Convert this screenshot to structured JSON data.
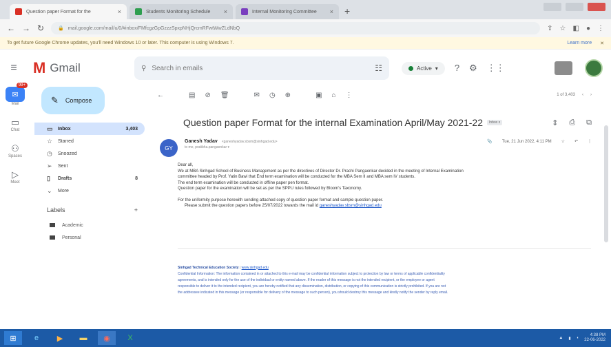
{
  "browser": {
    "tabs": [
      {
        "title": "Question paper Format for the",
        "active": true
      },
      {
        "title": "Students Monitoring Schedule",
        "active": false
      },
      {
        "title": "Internal Monitoring Committee",
        "active": false
      }
    ],
    "new_tab": "+",
    "url": "mail.google.com/mail/u/0/#inbox/FMfcgzGpGzzzSpxpNHjQrcmRFwtWwZLdNbQ",
    "infobar_text": "To get future Google Chrome updates, you'll need Windows 10 or later. This computer is using Windows 7.",
    "infobar_link": "Learn more"
  },
  "gmail": {
    "logo_text": "Gmail",
    "search_placeholder": "Search in emails",
    "status": "Active",
    "rail": [
      {
        "label": "Mail",
        "icon": "mail-icon",
        "badge": "99+"
      },
      {
        "label": "Chat",
        "icon": "chat-icon"
      },
      {
        "label": "Spaces",
        "icon": "spaces-icon"
      },
      {
        "label": "Meet",
        "icon": "video-icon"
      }
    ],
    "compose_label": "Compose",
    "nav": [
      {
        "label": "Inbox",
        "count": "3,403",
        "icon": "inbox-icon",
        "selected": true
      },
      {
        "label": "Starred",
        "count": "",
        "icon": "star-icon",
        "selected": false
      },
      {
        "label": "Snoozed",
        "count": "",
        "icon": "clock-icon",
        "selected": false
      },
      {
        "label": "Sent",
        "count": "",
        "icon": "send-icon",
        "selected": false
      },
      {
        "label": "Drafts",
        "count": "8",
        "icon": "draft-icon",
        "selected": false
      },
      {
        "label": "More",
        "count": "",
        "icon": "chevron-down-icon",
        "selected": false
      }
    ],
    "labels_title": "Labels",
    "labels_add": "+",
    "labels": [
      {
        "name": "Academic"
      },
      {
        "name": "Personal"
      }
    ],
    "pager_text": "1 of 3,403"
  },
  "email": {
    "subject": "Question paper Format for the internal Examination April/May 2021-22",
    "folder_chip": "Inbox x",
    "sender_initials": "GY",
    "sender_name": "Ganesh Yadav",
    "sender_email": "<ganeshyadav.sbsm@sinhgad.edu>",
    "to_text": "to me, pratibha.pangaonkar",
    "timestamp": "Tue, 21 Jun 2022, 4:11 PM",
    "body": [
      "Dear all,",
      "We at MBA Sinhgad School of Business Management as per the directives of Director Dr. Prachi Pangaonkar decided in the meeting of Internal Examination",
      "committee headed by Prof. Yatin Bawi that End term examination will be conducted for the MBA Sem II and MBA sem IV students.",
      "The end term examination will be conducted in offline paper pen format.",
      "Question paper for the examination will be set as per the SPPU rules followed by Bloom's Taxonomy.",
      "",
      "For the uniformity purpose herewith sending attached copy of question paper format and sample question paper.",
      "Please submit the question papers before 25/07/2022 towards the mail id"
    ],
    "mailto": "ganeshyadav.sbsm@sinhgad.edu",
    "footer_org": "Sinhgad Technical Education Society",
    "footer_link": "www.sinhgad.edu",
    "footer_text": [
      "Confidential Information: The information contained in or attached to this e-mail may be confidential information subject to protection by law or terms of applicable confidentiality",
      "agreements, and is intended only for the use of the individual or entity named above. If the reader of this message is not the intended recipient, or the employee or agent",
      "responsible to deliver it to the intended recipient, you are hereby notified that any dissemination, distribution, or copying of this communication is strictly prohibited. If you are not",
      "the addressee indicated in this message (or responsible for delivery of the message to such person), you should destroy this message and kindly notify the sender by reply email."
    ]
  },
  "taskbar": {
    "time": "4:38 PM",
    "date": "22-06-2022"
  },
  "colors": {
    "accent": "#c2e7ff",
    "selected_nav": "#d3e3fd",
    "gmail_red": "#d93025",
    "taskbar": "#1c5aa6"
  }
}
